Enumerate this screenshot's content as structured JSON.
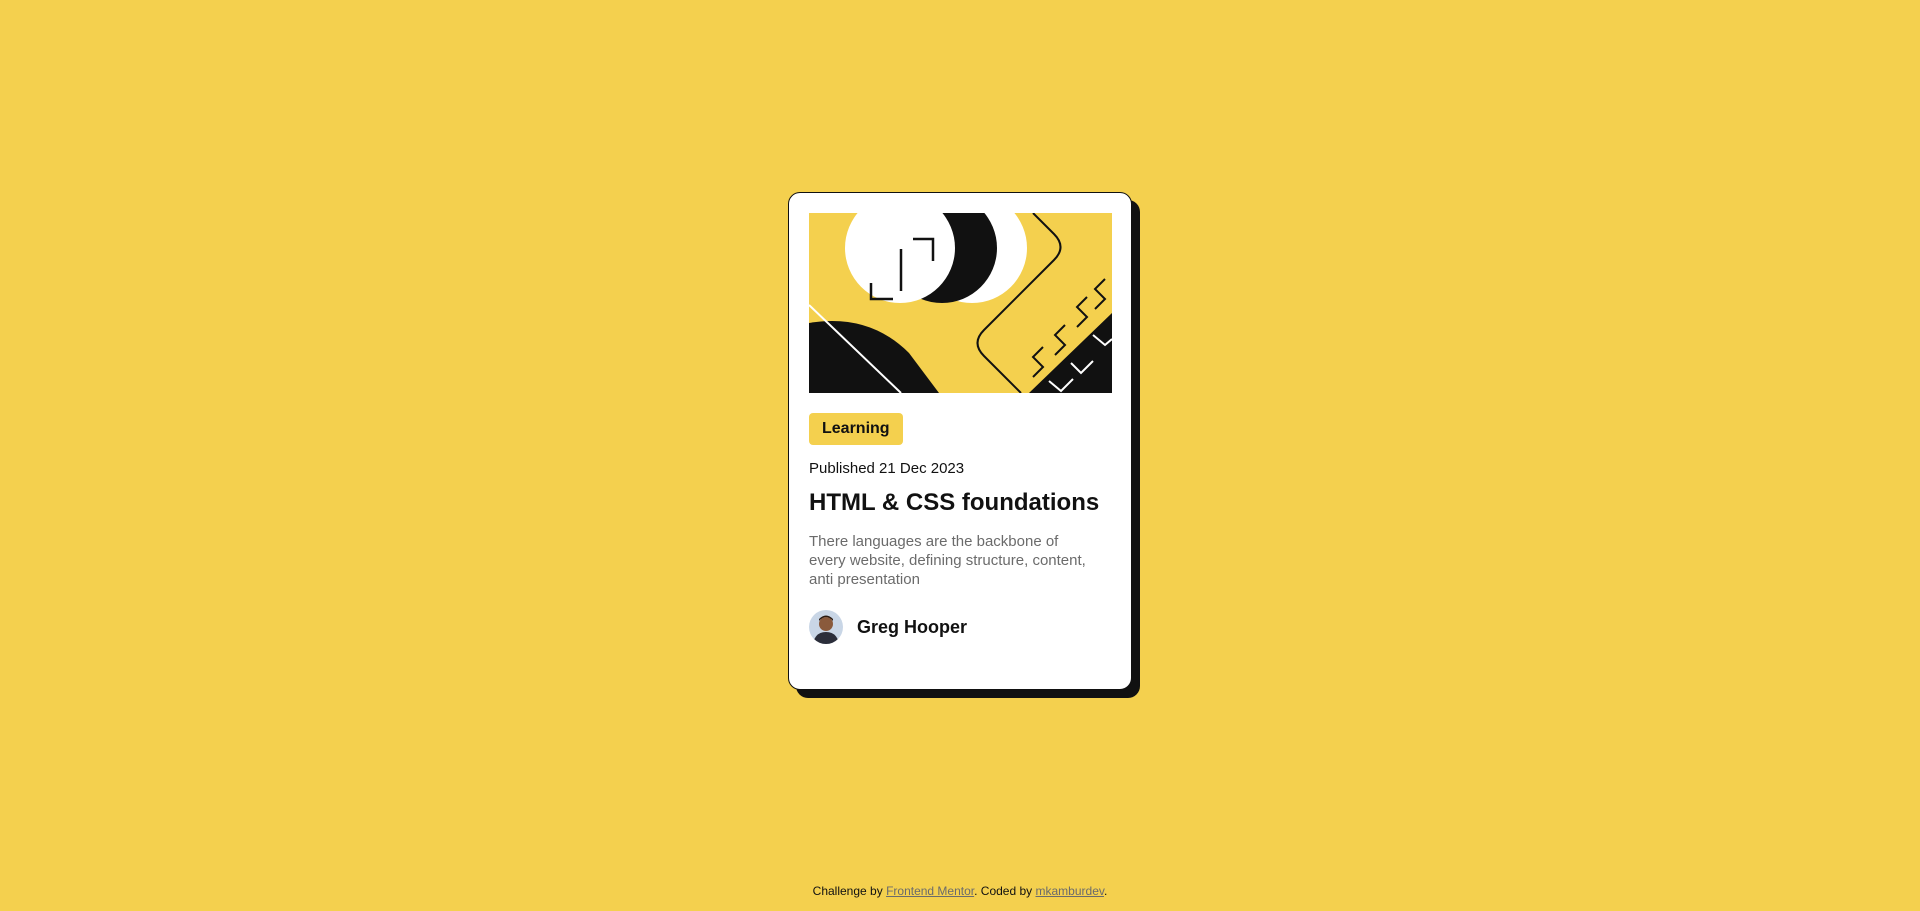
{
  "colors": {
    "background": "#F4D04E",
    "card": "#FFFFFF",
    "ink": "#111111",
    "muted": "#6B6B6B"
  },
  "card": {
    "illustration_icon": "abstract-illustration",
    "tag": "Learning",
    "published": "Published 21 Dec 2023",
    "title": "HTML & CSS foundations",
    "description": "There languages are the backbone of every website, defining structure, content, anti presentation",
    "author": {
      "avatar_icon": "avatar-portrait",
      "name": "Greg Hooper"
    }
  },
  "footer": {
    "prefix": "Challenge by",
    "challenge_link": "Frontend Mentor",
    "middle": ". Coded by",
    "coder_link": "mkamburdev",
    "suffix": "."
  }
}
